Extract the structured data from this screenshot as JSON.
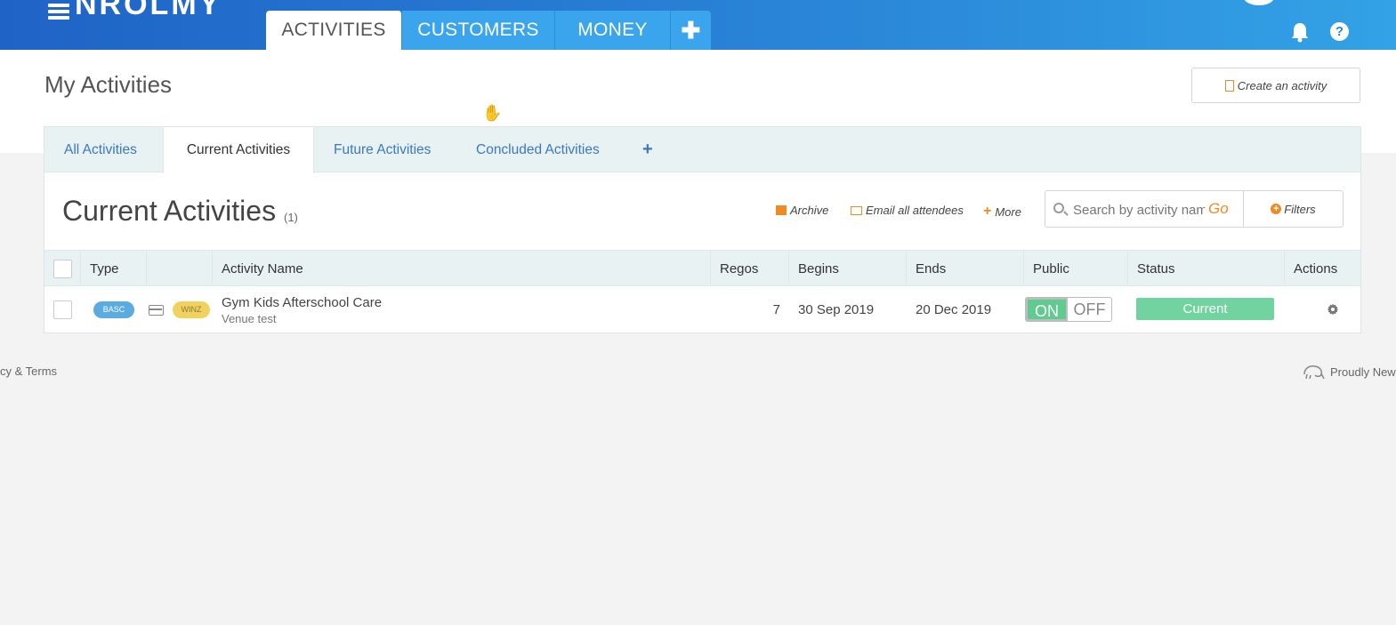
{
  "app": {
    "logo_text": "NROLMY"
  },
  "main_tabs": [
    {
      "label": "ACTIVITIES"
    },
    {
      "label": "CUSTOMERS"
    },
    {
      "label": "MONEY"
    },
    {
      "label": "✚"
    }
  ],
  "header": {
    "help_label": "?",
    "page_title": "My Activities",
    "create_button": "Create an activity"
  },
  "sub_tabs": [
    {
      "label": "All Activities"
    },
    {
      "label": "Current Activities"
    },
    {
      "label": "Future Activities"
    },
    {
      "label": "Concluded Activities"
    },
    {
      "label": "+"
    }
  ],
  "section": {
    "title": "Current Activities",
    "count": "(1)",
    "archive_label": "Archive",
    "email_label": "Email all attendees",
    "more_label": "More",
    "more_icon": "+",
    "filters_label": "Filters",
    "filters_icon": "+"
  },
  "search": {
    "placeholder": "Search by activity name",
    "go_label": "Go"
  },
  "table": {
    "headers": {
      "type": "Type",
      "name": "Activity Name",
      "regos": "Regos",
      "begins": "Begins",
      "ends": "Ends",
      "public": "Public",
      "status": "Status",
      "actions": "Actions"
    },
    "rows": [
      {
        "type_badge": "BASC",
        "funding_badge": "WINZ",
        "name": "Gym Kids Afterschool Care",
        "venue": "Venue test",
        "regos": "7",
        "begins": "30 Sep 2019",
        "ends": "20 Dec 2019",
        "public_on": "ON",
        "public_off": "OFF",
        "status": "Current"
      }
    ]
  },
  "footer": {
    "left": "cy & Terms",
    "right": "Proudly New"
  },
  "colors": {
    "brand_blue": "#2a86d8",
    "accent_orange": "#f08a24",
    "status_green": "#71d4a0",
    "toggle_green": "#5fcb90"
  }
}
